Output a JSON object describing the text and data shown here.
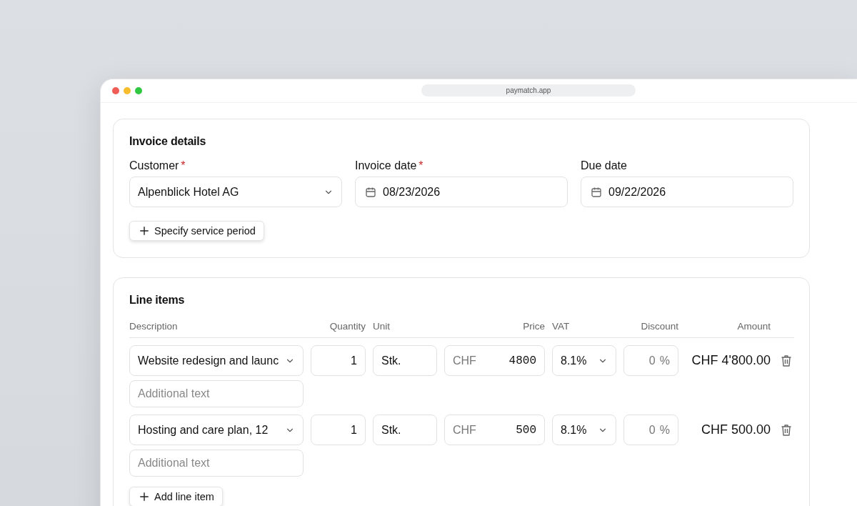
{
  "browser": {
    "url": "paymatch.app"
  },
  "invoice_details": {
    "title": "Invoice details",
    "required_mark": "*",
    "fields": [
      {
        "kind": "select",
        "label": "Customer",
        "required": true,
        "value": "Alpenblick Hotel AG"
      },
      {
        "kind": "date",
        "label": "Invoice date",
        "required": true,
        "value": "08/23/2026"
      },
      {
        "kind": "date",
        "label": "Due date",
        "required": false,
        "value": "09/22/2026"
      }
    ],
    "button": "Specify service period"
  },
  "line_items": {
    "title": "Line items",
    "columns": [
      "Description",
      "Quantity",
      "Unit",
      "Price",
      "VAT",
      "Discount",
      "Amount"
    ],
    "rows": [
      {
        "description": "Website redesign and launc",
        "additional_text_placeholder": "Additional text",
        "quantity": "1",
        "unit": "Stk.",
        "currency": "CHF",
        "price": "4800",
        "vat": "8.1%",
        "discount_placeholder": "0",
        "discount_unit": "%",
        "amount": "CHF 4'800.00"
      },
      {
        "description": "Hosting and care plan, 12",
        "additional_text_placeholder": "Additional text",
        "quantity": "1",
        "unit": "Stk.",
        "currency": "CHF",
        "price": "500",
        "vat": "8.1%",
        "discount_placeholder": "0",
        "discount_unit": "%",
        "amount": "CHF 500.00"
      }
    ],
    "button": "Add line item"
  }
}
